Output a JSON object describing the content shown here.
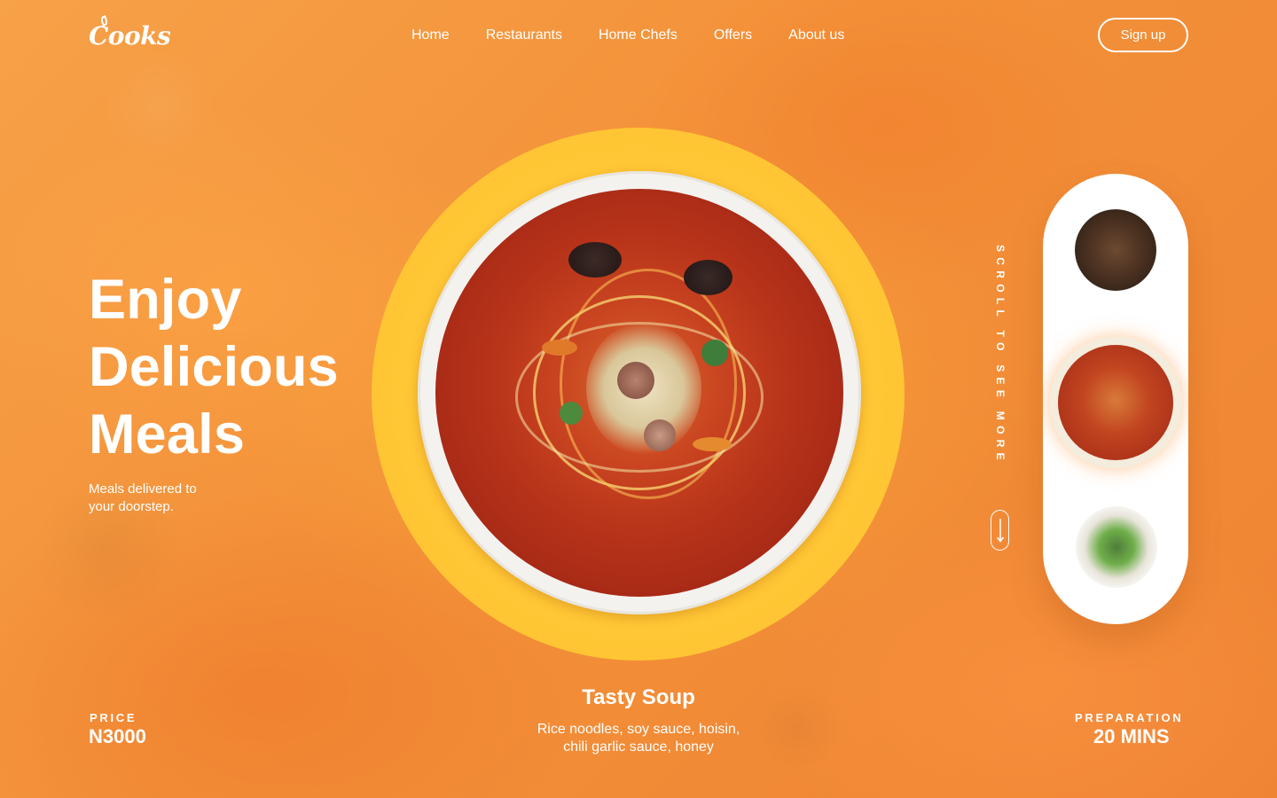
{
  "brand": {
    "logo_text": "Cooks"
  },
  "nav": {
    "items": [
      {
        "label": "Home"
      },
      {
        "label": "Restaurants"
      },
      {
        "label": "Home Chefs"
      },
      {
        "label": "Offers"
      },
      {
        "label": "About us"
      }
    ],
    "signup_label": "Sign up"
  },
  "hero": {
    "title_lines": [
      "Enjoy",
      "Delicious",
      "Meals"
    ],
    "subtitle_lines": [
      "Meals delivered to",
      "your doorstep."
    ]
  },
  "featured": {
    "dish_name": "Tasty Soup",
    "description_lines": [
      "Rice noodles, soy sauce, hoisin,",
      "chili garlic sauce, honey"
    ],
    "price_label": "PRICE",
    "price_value": "N3000",
    "prep_label": "PREPARATION",
    "prep_value": "20 MINS"
  },
  "scroll_hint": {
    "text": "SCROLL TO SEE MORE",
    "icon": "arrow-down-icon"
  },
  "side_menu": {
    "items": [
      {
        "name": "beef-stew-thumbnail",
        "selected": false
      },
      {
        "name": "tasty-soup-thumbnail",
        "selected": true
      },
      {
        "name": "poke-bowl-thumbnail",
        "selected": false
      }
    ]
  },
  "colors": {
    "background": "#f3913a",
    "halo": "#ffc836",
    "text": "#ffffff",
    "card": "#ffffff"
  }
}
